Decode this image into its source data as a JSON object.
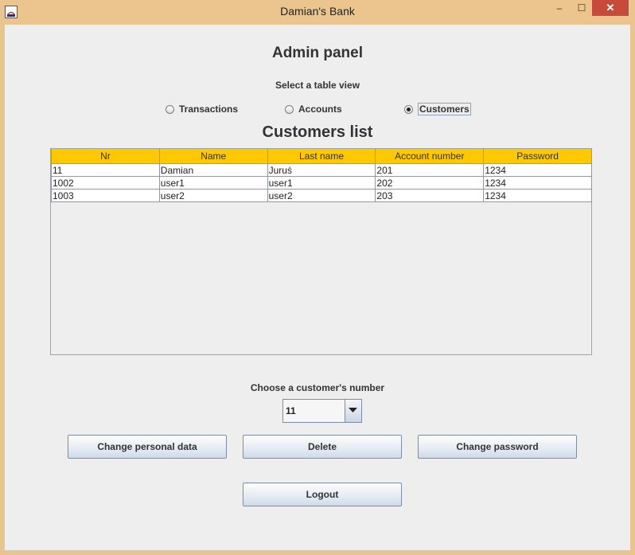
{
  "window": {
    "title": "Damian's Bank",
    "minimize": "–",
    "maximize": "☐",
    "close": "✕"
  },
  "main": {
    "heading": "Admin panel",
    "select_label": "Select a table view",
    "radios": [
      {
        "label": "Transactions",
        "checked": false
      },
      {
        "label": "Accounts",
        "checked": false
      },
      {
        "label": "Customers",
        "checked": true
      }
    ],
    "list_title": "Customers list"
  },
  "table": {
    "columns": [
      "Nr",
      "Name",
      "Last name",
      "Account number",
      "Password"
    ],
    "rows": [
      [
        "11",
        "Damian",
        "Juruś",
        "201",
        "1234"
      ],
      [
        "1002",
        "user1",
        "user1",
        "202",
        "1234"
      ],
      [
        "1003",
        "user2",
        "user2",
        "203",
        "1234"
      ]
    ],
    "header_color": "#ffc800"
  },
  "customer_select": {
    "label": "Choose a customer's number",
    "value": "11"
  },
  "buttons": {
    "change_personal": "Change personal data",
    "delete": "Delete",
    "change_password": "Change password",
    "logout": "Logout"
  }
}
